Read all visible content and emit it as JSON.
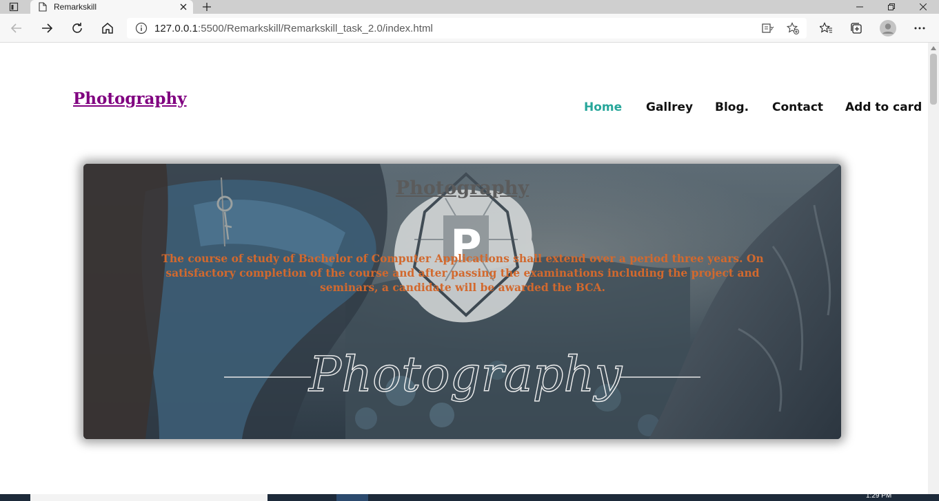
{
  "browser": {
    "tab_title": "Remarkskill",
    "url_host": "127.0.0.1",
    "url_rest": ":5500/Remarkskill/Remarkskill_task_2.0/index.html",
    "toolbar_icons": [
      "back-arrow-icon",
      "forward-arrow-icon",
      "refresh-icon",
      "home-icon"
    ],
    "address_icons": [
      "info-icon",
      "immersive-reader-icon",
      "favorite-add-icon"
    ],
    "right_icons": [
      "favorites-icon",
      "collections-icon",
      "profile-avatar-icon",
      "more-icon"
    ]
  },
  "site": {
    "logo": "Photography",
    "nav": [
      {
        "label": "Home",
        "active": true
      },
      {
        "label": "Gallrey",
        "active": false
      },
      {
        "label": "Blog.",
        "active": false
      },
      {
        "label": "Contact",
        "active": false
      },
      {
        "label": "Add to card",
        "active": false
      }
    ],
    "colors": {
      "logo": "#800080",
      "nav_active": "#26a69a",
      "hero_text": "#d2692e"
    }
  },
  "hero": {
    "title": "Photography",
    "text": "The course of study of Bachelor of Computer Applications shall extend over a period three years. On satisfactory completion of the course and after passing the examinations including the project and seminars, a candidate will be awarded the BCA.",
    "image_logo_letter": "P",
    "image_script_word": "Photography"
  },
  "taskbar": {
    "clock": "1:29 PM"
  }
}
